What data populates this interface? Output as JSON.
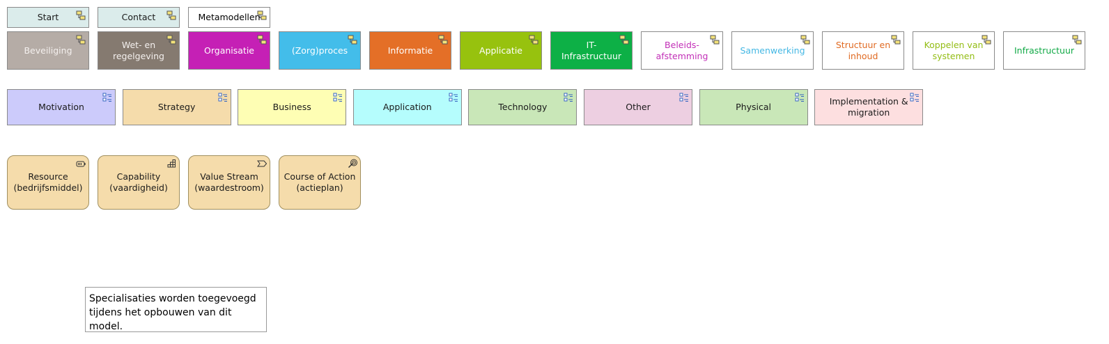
{
  "nav_row": [
    {
      "label": "Start",
      "fill": "#dbeceb",
      "text": "#1a1a1a",
      "icon": "model-ref-icon"
    },
    {
      "label": "Contact",
      "fill": "#dbeceb",
      "text": "#1a1a1a",
      "icon": "model-ref-icon"
    },
    {
      "label": "Metamodellen",
      "fill": "#dbeceb",
      "text": "#1a1a1a",
      "icon": "model-ref-icon"
    }
  ],
  "domain_row": [
    {
      "label": "Beveiliging",
      "fill": "#b5aca6",
      "text": "#f4f0ee",
      "icon": "model-ref-icon"
    },
    {
      "label": "Wet- en\nregelgeving",
      "fill": "#857a70",
      "text": "#f4f0ee",
      "icon": "model-ref-icon"
    },
    {
      "label": "Organisatie",
      "fill": "#c520b5",
      "text": "#ffffff",
      "icon": "model-ref-icon"
    },
    {
      "label": "(Zorg)proces",
      "fill": "#43bdea",
      "text": "#ffffff",
      "icon": "model-ref-icon"
    },
    {
      "label": "Informatie",
      "fill": "#e46f27",
      "text": "#ffffff",
      "icon": "model-ref-icon"
    },
    {
      "label": "Applicatie",
      "fill": "#97c20e",
      "text": "#ffffff",
      "icon": "model-ref-icon"
    },
    {
      "label": "IT-Infrastructuur",
      "fill": "#0db046",
      "text": "#ffffff",
      "icon": "model-ref-icon"
    },
    {
      "label": "Beleids-\nafstemming",
      "fill": "#ffffff",
      "text": "#c22fb7",
      "icon": "model-ref-icon"
    },
    {
      "label": "Samenwerking",
      "fill": "#ffffff",
      "text": "#45b8e4",
      "icon": "model-ref-icon"
    },
    {
      "label": "Structuur en\ninhoud",
      "fill": "#ffffff",
      "text": "#e06a22",
      "icon": "model-ref-icon"
    },
    {
      "label": "Koppelen van\nsystemen",
      "fill": "#ffffff",
      "text": "#93bd14",
      "icon": "model-ref-icon"
    },
    {
      "label": "Infrastructuur",
      "fill": "#ffffff",
      "text": "#11a946",
      "icon": "model-ref-icon"
    }
  ],
  "layer_row": [
    {
      "label": "Motivation",
      "fill": "#cccbfb",
      "icon": "grouping-icon"
    },
    {
      "label": "Strategy",
      "fill": "#f5dcab",
      "icon": "grouping-icon"
    },
    {
      "label": "Business",
      "fill": "#fefeb4",
      "icon": "grouping-icon"
    },
    {
      "label": "Application",
      "fill": "#b5fdfd",
      "icon": "grouping-icon"
    },
    {
      "label": "Technology",
      "fill": "#c9e7b8",
      "icon": "grouping-icon"
    },
    {
      "label": "Other",
      "fill": "#edcfe1",
      "icon": "grouping-icon"
    },
    {
      "label": "Physical",
      "fill": "#c9e7b8",
      "icon": "grouping-icon"
    },
    {
      "label": "Implementation &\nmigration",
      "fill": "#fddfe0",
      "icon": "grouping-icon"
    }
  ],
  "strategy_row": [
    {
      "label": "Resource\n(bedrijfsmiddel)",
      "fill": "#f5dcab",
      "icon": "resource-icon"
    },
    {
      "label": "Capability\n(vaardigheid)",
      "fill": "#f5dcab",
      "icon": "capability-icon"
    },
    {
      "label": "Value Stream\n(waardestroom)",
      "fill": "#f5dcab",
      "icon": "value-stream-icon"
    },
    {
      "label": "Course of Action\n(actieplan)",
      "fill": "#f5dcab",
      "icon": "course-of-action-icon"
    }
  ],
  "note": {
    "text": "Specialisaties worden toegevoegd\ntijdens het opbouwen van dit model."
  }
}
